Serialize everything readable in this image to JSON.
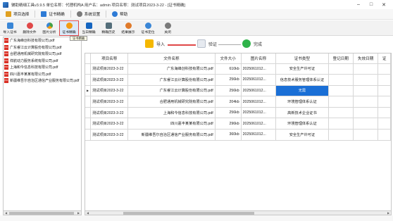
{
  "window": {
    "title": "辅助精细工具v3.9.5 单位名称：代理机构A 用户名：admin 项目名称：测试项目2023-3-22 - [证书精确]",
    "minimize": "–",
    "maximize": "□",
    "close": "✕"
  },
  "menu": {
    "items": [
      {
        "label": "项目选择",
        "color": "#e0a020"
      },
      {
        "label": "证书精确",
        "color": "#2e7bd6"
      },
      {
        "label": "系统设置",
        "color": "#7a7a7a"
      },
      {
        "label": "帮助",
        "color": "#2e7bd6"
      }
    ]
  },
  "ribbon": {
    "buttons": [
      {
        "label": "导入证书",
        "color": "#3a86d6"
      },
      {
        "label": "删除文件",
        "color": "#e04848"
      },
      {
        "label": "图片分析",
        "color": "#43a047"
      },
      {
        "label": "证书精确",
        "color": "#f39c12"
      },
      {
        "label": "当日精确",
        "color": "#1565c0"
      },
      {
        "label": "精确历史",
        "color": "#546e7a"
      },
      {
        "label": "结果展示",
        "color": "#e07a2a"
      },
      {
        "label": "证书定位",
        "color": "#3a86d6"
      },
      {
        "label": "关闭",
        "color": "#7a7a7a"
      }
    ],
    "tooltip": "证书精确"
  },
  "files": [
    "广东海峰创科技有限公司.pdf",
    "广东睿江云计算股份有限公司.pdf",
    "合肥通用机械研究院有限公司.pdf",
    "祥航动力服务系统有限公司.pdf",
    "上海和今信息科技有限公司.pdf",
    "四川嘉丰某某有限公司.pdf",
    "新疆维吾尔自治区通信产业服务有限公司.pdf"
  ],
  "steps": [
    {
      "label": "导入",
      "color": "#f5b800"
    },
    {
      "label": "验证",
      "color": "#e6eaf0"
    },
    {
      "label": "完成",
      "color": "#2fb34a"
    }
  ],
  "grid": {
    "columns": [
      "项目名称",
      "文件名称",
      "文件大小",
      "图片名称",
      "证书类型",
      "登记日期",
      "失效日期",
      "证"
    ],
    "rows": [
      {
        "marker": "",
        "cells": [
          "测试项目2023-3-22",
          "广东海峰创科技有限公司.pdf",
          "610kb",
          "2025061012...",
          "安全生产许可证",
          "",
          "",
          ""
        ]
      },
      {
        "marker": "",
        "cells": [
          "测试项目2023-3-22",
          "广东睿江云计算股份有限公司.pdf",
          "256kb",
          "2025061012...",
          "信息技术服务管理体系认证",
          "",
          "",
          ""
        ]
      },
      {
        "marker": "▶",
        "cells": [
          "测试项目2023-3-22",
          "广东睿江云计算股份有限公司.pdf",
          "256kb",
          "2025061012...",
          "无需",
          "",
          "",
          ""
        ]
      },
      {
        "marker": "",
        "cells": [
          "测试项目2023-3-22",
          "合肥通用机械研究院有限公司.pdf",
          "204kb",
          "2025061012...",
          "环境管理体系认证",
          "",
          "",
          ""
        ]
      },
      {
        "marker": "",
        "cells": [
          "测试项目2023-3-22",
          "上海和今信息科技有限公司.pdf",
          "256kb",
          "2025061012...",
          "高新技术企业证书",
          "",
          "",
          ""
        ]
      },
      {
        "marker": "",
        "cells": [
          "测试项目2023-3-22",
          "四川嘉丰某某有限公司.pdf",
          "296kb",
          "2025061012...",
          "环境管理体系认证",
          "",
          "",
          ""
        ]
      },
      {
        "marker": "",
        "cells": [
          "测试项目2023-3-22",
          "新疆维吾尔自治区通信产业服务有限公司.pdf",
          "360kb",
          "2025061012...",
          "安全生产许可证",
          "",
          "",
          ""
        ]
      }
    ],
    "selected_row": 2,
    "selected_col": 4
  },
  "scroll": {
    "left": "◀",
    "right": "▶"
  },
  "colors": {
    "accent": "#1a6fd6",
    "highlight": "#e04848"
  }
}
